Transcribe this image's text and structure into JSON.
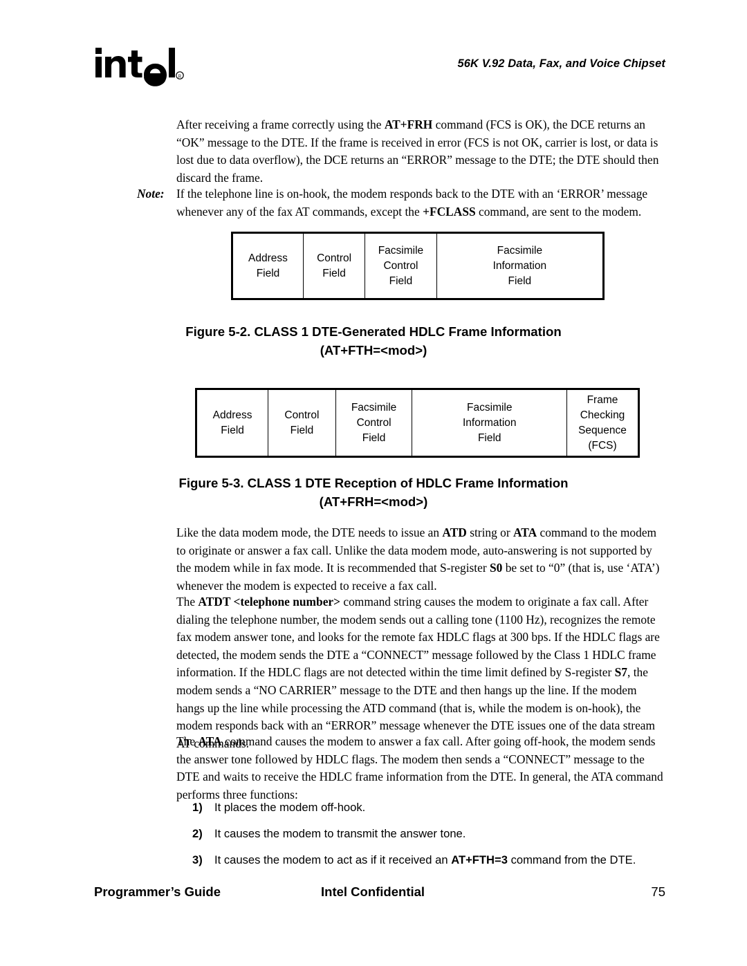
{
  "header": {
    "logo_text": "intel",
    "logo_trademark": "®",
    "title": "56K V.92 Data, Fax, and Voice Chipset"
  },
  "body": {
    "paragraph_1": "After receiving a frame correctly using the <b>AT+FRH</b> command (FCS is OK), the DCE returns an “OK” message to the DTE. If the frame is received in error (FCS is not OK, carrier is lost, or data is lost due to data overflow), the DCE returns an “ERROR” message to the DTE; the DTE should then discard the frame.",
    "note_label": "Note:",
    "note_text": "If the telephone line is on-hook, the modem responds back to the DTE with an ‘ERROR’ message whenever any of the fax AT commands, except the <b>+FCLASS</b> command, are sent to the modem.",
    "paragraph_2": "Like the data modem mode, the DTE needs to issue an <b>ATD</b> string or <b>ATA</b> command to the modem to originate or answer a fax call. Unlike the data modem mode, auto-answering is not supported by the modem while in fax mode. It is recommended that S-register <b>S0</b> be set to “0” (that is, use ‘ATA’) whenever the modem is expected to receive a fax call.",
    "paragraph_3": "The <b>ATDT &lt;telephone number&gt;</b> command string causes the modem to originate a fax call. After dialing the telephone number, the modem sends out a calling tone (1100 Hz), recognizes the remote fax modem answer tone, and looks for the remote fax HDLC flags at 300 bps. If the HDLC flags are detected, the modem sends the DTE a “CONNECT” message followed by the Class 1 HDLC frame information. If the HDLC flags are not detected within the time limit defined by S-register <b>S7</b>, the modem sends a “NO CARRIER” message to the DTE and then hangs up the line. If the modem hangs up the line while processing the ATD command (that is, while the modem is on-hook), the modem responds back with an “ERROR” message whenever the DTE issues one of the data stream AT commands.",
    "paragraph_4": "The <b>ATA</b> command causes the modem to answer a fax call. After going off-hook, the modem sends the answer tone followed by HDLC flags. The modem then sends a “CONNECT” message to the DTE and waits to receive the HDLC frame information from the DTE. In general, the ATA command performs three functions:"
  },
  "figure_5_2": {
    "caption_line1": "Figure 5-2.  CLASS 1 DTE-Generated HDLC Frame Information",
    "caption_line2": "(AT+FTH=<mod>)",
    "cells": [
      {
        "lines": [
          "Address",
          "Field"
        ]
      },
      {
        "lines": [
          "Control",
          "Field"
        ]
      },
      {
        "lines": [
          "Facsimile",
          "Control",
          "Field"
        ]
      },
      {
        "lines": [
          "Facsimile",
          "Information",
          "Field"
        ]
      }
    ]
  },
  "figure_5_3": {
    "caption_line1": "Figure 5-3.  CLASS 1 DTE Reception of HDLC Frame Information",
    "caption_line2": "(AT+FRH=<mod>)",
    "cells": [
      {
        "lines": [
          "Address",
          "Field"
        ]
      },
      {
        "lines": [
          "Control",
          "Field"
        ]
      },
      {
        "lines": [
          "Facsimile",
          "Control",
          "Field"
        ]
      },
      {
        "lines": [
          "Facsimile",
          "Information",
          "Field"
        ]
      },
      {
        "lines": [
          "Frame",
          "Checking",
          "Sequence",
          "(FCS)"
        ]
      }
    ]
  },
  "ata_functions": [
    {
      "number": "1)",
      "text": "It places the modem off-hook."
    },
    {
      "number": "2)",
      "text": "It causes the modem to transmit the answer tone."
    },
    {
      "number": "3)",
      "text": "It causes the modem to act as if it received an <b>AT+FTH=3</b> command from the DTE."
    }
  ],
  "footer": {
    "left": "Programmer’s Guide",
    "center": "Intel Confidential",
    "page_number": "75"
  }
}
